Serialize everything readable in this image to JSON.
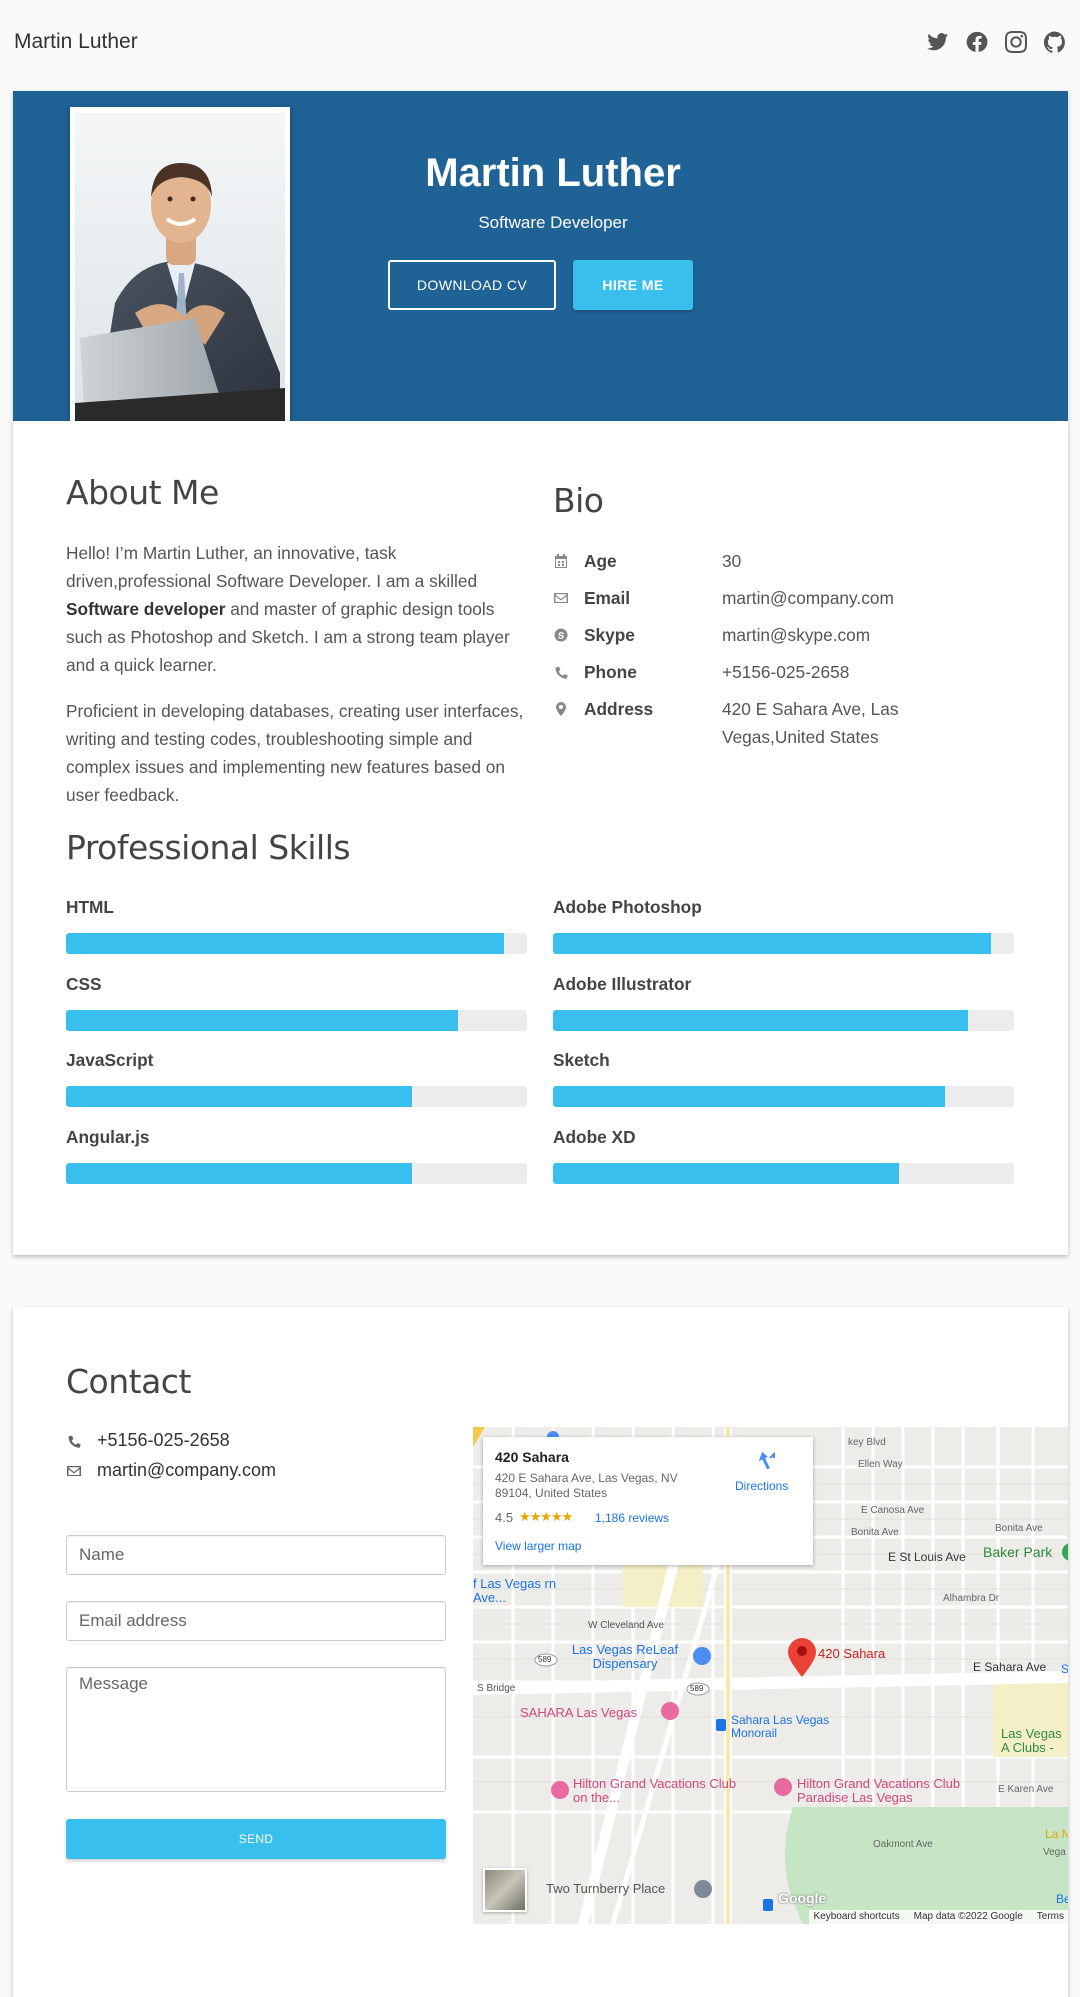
{
  "nav": {
    "brand": "Martin Luther",
    "socials": [
      "twitter-icon",
      "facebook-icon",
      "instagram-icon",
      "github-icon"
    ]
  },
  "hero": {
    "name": "Martin Luther",
    "role": "Software Developer",
    "download_cv": "DOWNLOAD CV",
    "hire_me": "HIRE ME"
  },
  "about": {
    "title": "About Me",
    "p1_a": "Hello! I’m Martin Luther, an innovative, task driven,professional Software Developer. I am a skilled ",
    "p1_bold": "Software developer",
    "p1_b": " and master of graphic design tools such as Photoshop and Sketch. I am a strong team player and a quick learner.",
    "p2": "Proficient in developing databases, creating user interfaces, writing and testing codes, troubleshooting simple and complex issues and implementing new features based on user feedback."
  },
  "bio": {
    "title": "Bio",
    "rows": [
      {
        "icon": "calendar-icon",
        "label": "Age",
        "value": "30"
      },
      {
        "icon": "envelope-icon",
        "label": "Email",
        "value": "martin@company.com"
      },
      {
        "icon": "skype-icon",
        "label": "Skype",
        "value": "martin@skype.com"
      },
      {
        "icon": "phone-icon",
        "label": "Phone",
        "value": "+5156-025-2658"
      },
      {
        "icon": "map-marker-icon",
        "label": "Address",
        "value": "420 E Sahara Ave, Las Vegas,United States"
      }
    ]
  },
  "skills": {
    "title": "Professional Skills",
    "items": [
      {
        "name": "HTML",
        "level": 0.95
      },
      {
        "name": "Adobe Photoshop",
        "level": 0.95
      },
      {
        "name": "CSS",
        "level": 0.85
      },
      {
        "name": "Adobe Illustrator",
        "level": 0.9
      },
      {
        "name": "JavaScript",
        "level": 0.75
      },
      {
        "name": "Sketch",
        "level": 0.85
      },
      {
        "name": "Angular.js",
        "level": 0.75
      },
      {
        "name": "Adobe XD",
        "level": 0.75
      }
    ],
    "bar_color": "#39bfed"
  },
  "contact": {
    "title": "Contact",
    "phone": "+5156-025-2658",
    "email": "martin@company.com",
    "name_placeholder": "Name",
    "email_placeholder": "Email address",
    "message_placeholder": "Message",
    "send": "SEND"
  },
  "map": {
    "card_title": "420 Sahara",
    "card_address": "420 E Sahara Ave, Las Vegas, NV 89104, United States",
    "rating": "4.5",
    "stars": "★★★★★",
    "reviews": "1,186 reviews",
    "larger_map": "View larger map",
    "directions": "Directions",
    "pin_label": "420 Sahara",
    "labels": {
      "kay_blvd": "key Blvd",
      "ellen_way": "Ellen Way",
      "e_canosa": "E Canosa Ave",
      "bonita_ave": "Bonita Ave",
      "bonita_ave2": "Bonita Ave",
      "e_st_louis": "E St Louis Ave",
      "baker_park": "Baker Park",
      "alhambra": "Alhambra Dr",
      "w_cleveland": "W Cleveland Ave",
      "releaf": "Las Vegas ReLeaf Dispensary",
      "e_sahara": "E Sahara Ave",
      "sahara_lv": "SAHARA Las Vegas",
      "monorail": "Sahara Las Vegas Monorail",
      "clubs": "Las Vegas A Clubs -",
      "hilton1": "Hilton Grand Vacations Club on the...",
      "hilton2": "Hilton Grand Vacations Club Paradise Las Vegas",
      "e_karen": "E Karen Ave",
      "oakmont": "Oakmont Ave",
      "turnberry": "Two Turnberry Place",
      "s_bridge": "S Bridge",
      "fun_ave": "f Las Vegas rn Ave...",
      "keyboard": "Keyboard shortcuts",
      "mapdata": "Map data ©2022 Google",
      "terms": "Terms",
      "google": "Google",
      "r589": "589",
      "r589b": "589",
      "la_n": "La N",
      "vega": "Vega",
      "bea": "Bea",
      "sm": "Sm"
    }
  }
}
